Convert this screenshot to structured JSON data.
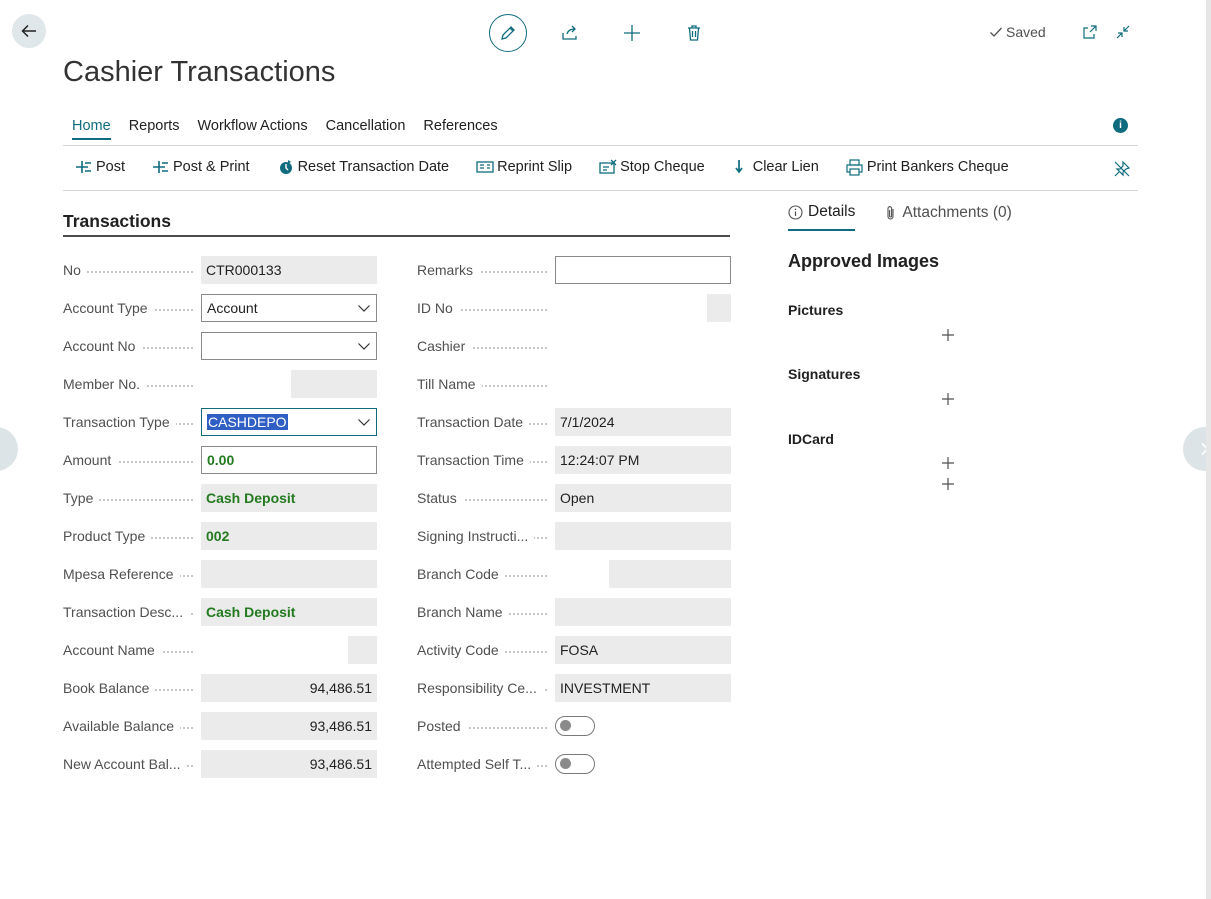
{
  "header": {
    "saved_label": "Saved",
    "title": "Cashier Transactions"
  },
  "menu": {
    "tabs": [
      "Home",
      "Reports",
      "Workflow Actions",
      "Cancellation",
      "References"
    ]
  },
  "actions": {
    "post": "Post",
    "post_print": "Post & Print",
    "reset_date": "Reset Transaction Date",
    "reprint_slip": "Reprint Slip",
    "stop_cheque": "Stop Cheque",
    "clear_lien": "Clear Lien",
    "print_bankers": "Print Bankers Cheque"
  },
  "section": {
    "title": "Transactions"
  },
  "left_fields": {
    "no": {
      "label": "No",
      "value": "CTR000133"
    },
    "account_type": {
      "label": "Account Type",
      "value": "Account"
    },
    "account_no": {
      "label": "Account No",
      "value": ""
    },
    "member_no": {
      "label": "Member No.",
      "value": ""
    },
    "transaction_type": {
      "label": "Transaction Type",
      "value": "CASHDEPO"
    },
    "amount": {
      "label": "Amount",
      "value": "0.00"
    },
    "type": {
      "label": "Type",
      "value": "Cash Deposit"
    },
    "product_type": {
      "label": "Product Type",
      "value": "002"
    },
    "mpesa_reference": {
      "label": "Mpesa Reference",
      "value": ""
    },
    "transaction_desc": {
      "label": "Transaction Desc...",
      "value": "Cash Deposit"
    },
    "account_name": {
      "label": "Account Name",
      "value": ""
    },
    "book_balance": {
      "label": "Book Balance",
      "value": "94,486.51"
    },
    "available_balance": {
      "label": "Available Balance",
      "value": "93,486.51"
    },
    "new_account_balance": {
      "label": "New Account Bal...",
      "value": "93,486.51"
    }
  },
  "right_fields": {
    "remarks": {
      "label": "Remarks",
      "value": ""
    },
    "id_no": {
      "label": "ID No",
      "value": ""
    },
    "cashier": {
      "label": "Cashier",
      "value": ""
    },
    "till_name": {
      "label": "Till Name",
      "value": ""
    },
    "transaction_date": {
      "label": "Transaction Date",
      "value": "7/1/2024"
    },
    "transaction_time": {
      "label": "Transaction Time",
      "value": "12:24:07 PM"
    },
    "status": {
      "label": "Status",
      "value": "Open"
    },
    "signing_instructions": {
      "label": "Signing Instructi...",
      "value": ""
    },
    "branch_code": {
      "label": "Branch Code",
      "value": ""
    },
    "branch_name": {
      "label": "Branch Name",
      "value": ""
    },
    "activity_code": {
      "label": "Activity Code",
      "value": "FOSA"
    },
    "responsibility_center": {
      "label": "Responsibility Ce...",
      "value": "INVESTMENT"
    },
    "posted": {
      "label": "Posted",
      "value": false
    },
    "attempted_self_t": {
      "label": "Attempted Self T...",
      "value": false
    }
  },
  "factbox": {
    "details_tab": "Details",
    "attachments_tab": "Attachments (0)",
    "title": "Approved Images",
    "pictures": "Pictures",
    "signatures": "Signatures",
    "idcard": "IDCard"
  },
  "colors": {
    "accent": "#0f6c7e",
    "positive_value": "#237a1f",
    "selection": "#2f5ec4"
  }
}
